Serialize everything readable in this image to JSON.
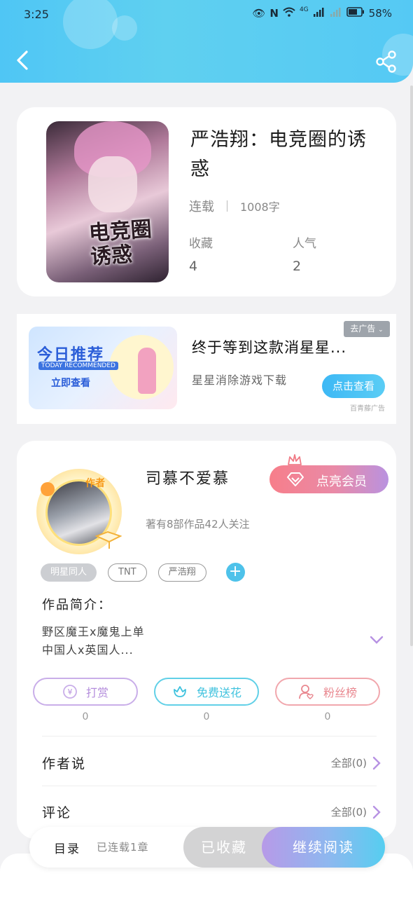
{
  "status_bar": {
    "time": "3:25",
    "network": "4G",
    "battery": "58%"
  },
  "header": {
    "back_icon": "chevron-left-icon",
    "share_icon": "share-icon",
    "gradient_start": "#4fc6f5",
    "gradient_end": "#55c9f4"
  },
  "book": {
    "title": "严浩翔：电竞圈的诱惑",
    "cover_title": "电竞圈 诱惑",
    "status": "连载",
    "word_count": "1008字",
    "stats": [
      {
        "label": "收藏",
        "value": "4"
      },
      {
        "label": "人气",
        "value": "2"
      }
    ]
  },
  "ad": {
    "image_title": "今日推荐",
    "image_subtitle": "TODAY RECOMMENDED",
    "image_cta": "立即查看",
    "title": "终于等到这款消星星...",
    "subtitle": "星星消除游戏下载",
    "tag": "去广告",
    "button": "点击查看",
    "source": "百青藤广告"
  },
  "author": {
    "badge": "作者",
    "name": "司慕不爱慕",
    "info": "著有8部作品42人关注",
    "vip_button": "点亮会员",
    "tags": [
      "明星同人",
      "TNT",
      "严浩翔"
    ],
    "intro_label": "作品简介：",
    "intro_lines": [
      "野区魔王x魔鬼上单",
      "中国人x英国人..."
    ],
    "actions": [
      {
        "label": "打赏",
        "count": "0",
        "icon": "yen-coin-icon"
      },
      {
        "label": "免费送花",
        "count": "0",
        "icon": "flower-icon"
      },
      {
        "label": "粉丝榜",
        "count": "0",
        "icon": "fan-user-icon"
      }
    ],
    "rows": [
      {
        "title": "作者说",
        "link": "全部(0)"
      },
      {
        "title": "评论",
        "link": "全部(0)"
      }
    ]
  },
  "bottom_bar": {
    "toc_label": "目录",
    "toc_status": "已连载1章",
    "collected_button": "已收藏",
    "read_button": "继续阅读"
  },
  "colors": {
    "accent_blue": "#4ec2ea",
    "vip_pink": "#f77e8a",
    "vip_purple": "#b992e0",
    "reward_purple": "#b48ddc",
    "flower_cyan": "#3fc2de",
    "fans_pink": "#e98890"
  }
}
